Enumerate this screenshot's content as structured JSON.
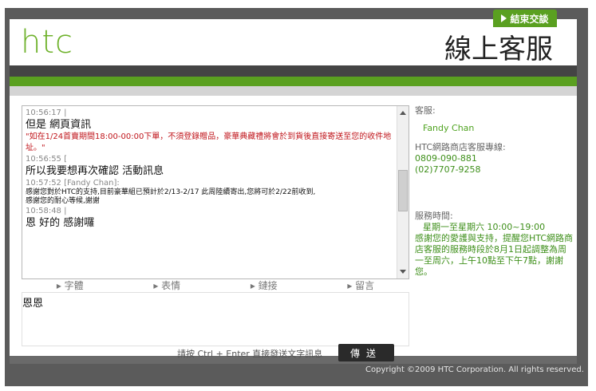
{
  "header": {
    "logo": "htc",
    "title": "線上客服",
    "end_chat": "結束交談"
  },
  "chat": {
    "messages": [
      {
        "time": "10:56:17 |",
        "text": "但是 網頁資訊",
        "kind": "big"
      },
      {
        "time": "",
        "text": "\"如在1/24首賣期間18:00-00:00下單，不須登錄贈品，豪華典藏禮將會於到貨後直接寄送至您的收件地址。\"",
        "kind": "red"
      },
      {
        "time": "10:56:55 [",
        "text": "所以我要想再次確認 活動訊息",
        "kind": "big"
      },
      {
        "time": "10:57:52 [Fandy Chan]:",
        "text": "感謝您對於HTC的支持,目前豪華組已預計於2/13-2/17 此周陸續寄出,您將可於2/22前收到,",
        "kind": "small"
      },
      {
        "time": "",
        "text": "感謝您的耐心等候,謝謝",
        "kind": "small"
      },
      {
        "time": "10:58:48 |",
        "text": "恩 好的  感謝囉",
        "kind": "big"
      }
    ]
  },
  "toolbar": {
    "font": "字體",
    "emotion": "表情",
    "link": "鏈接",
    "message": "留言"
  },
  "input": {
    "value": "恩恩"
  },
  "sidebar": {
    "agent_label": "客服:",
    "agent_name": "Fandy Chan",
    "hotline_label": "HTC網路商店客服專線:",
    "phone1": "0809-090-881",
    "phone2": "(02)7707-9258",
    "hours_label": "服務時間:",
    "hours": "星期一至星期六 10:00~19:00",
    "notice": "感謝您的愛護與支持，提醒您HTC網路商店客服的服務時段於8月1日起調整為周一至周六，上午10點至下午7點，謝謝您。"
  },
  "footer": {
    "tip": "請按 Ctrl + Enter 直接發送文字訊息",
    "send": "傳送",
    "copyright": "Copyright ©2009 HTC Corporation. All rights reserved."
  },
  "colors": {
    "accent_green": "#5aa020",
    "alert_red": "#c0161c",
    "frame_gray": "#5b5b5b"
  }
}
